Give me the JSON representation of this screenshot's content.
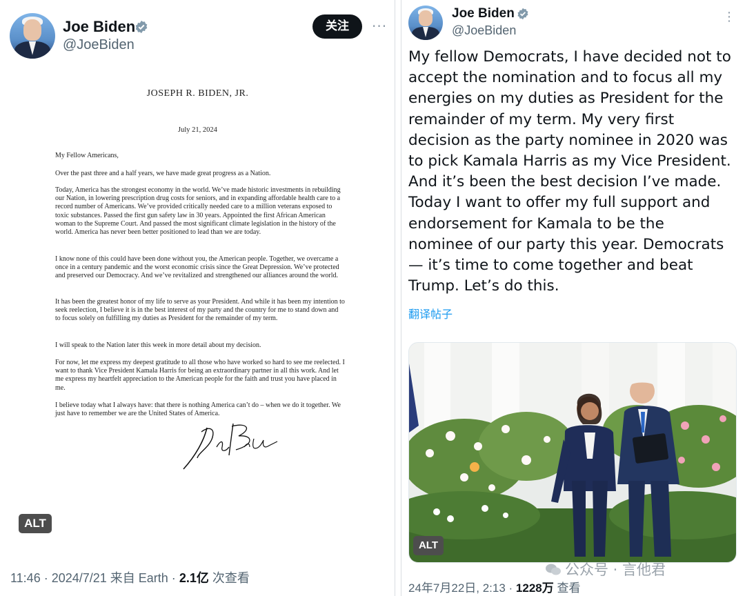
{
  "left_post": {
    "author": {
      "name": "Joe Biden",
      "handle": "@JoeBiden"
    },
    "follow_label": "关注",
    "more_label": "···",
    "letter": {
      "heading": "JOSEPH R. BIDEN, JR.",
      "date": "July 21, 2024",
      "salutation": "My Fellow Americans,",
      "paragraphs": [
        "Over the past three and a half years, we have made great progress as a Nation.",
        "Today, America has the strongest economy in the world. We’ve made historic investments in rebuilding our Nation, in lowering prescription drug costs for seniors, and in expanding affordable health care to a record number of Americans. We’ve provided critically needed care to a million veterans exposed to toxic substances. Passed the first gun safety law in 30 years. Appointed the first African American woman to the Supreme Court. And passed the most significant climate legislation in the history of the world. America has never been better positioned to lead than we are today.",
        "I know none of this could have been done without you, the American people. Together, we overcame a once in a century pandemic and the worst economic crisis since the Great Depression. We’ve protected and preserved our Democracy. And we’ve revitalized and strengthened our alliances around the world.",
        "It has been the greatest honor of my life to serve as your President. And while it has been my intention to seek reelection, I believe it is in the best interest of my party and the country for me to stand down and to focus solely on fulfilling my duties as President for the remainder of my term.",
        "I will speak to the Nation later this week in more detail about my decision.",
        "For now, let me express my deepest gratitude to all those who have worked so hard to see me reelected. I want to thank Vice President Kamala Harris for being an extraordinary partner in all this work. And let me express my heartfelt appreciation to the American people for the faith and trust you have placed in me.",
        "I believe today what I always have: that there is nothing America can’t do – when we do it together. We just have to remember we are the United States of America."
      ],
      "signature": "Joe Biden"
    },
    "alt_label": "ALT",
    "meta": {
      "time": "11:46 · 2024/7/21 来自 Earth · ",
      "views": "2.1亿",
      "views_suffix": " 次查看"
    }
  },
  "right_post": {
    "author": {
      "name": "Joe Biden",
      "handle": "@JoeBiden"
    },
    "more_label": "⋮",
    "text": "My fellow Democrats, I have decided not to accept the nomination and to focus all my energies on my duties as President for the remainder of my term. My very first decision as the party nominee in 2020 was to pick Kamala Harris as my Vice President. And it’s been the best decision I’ve made. Today I want to offer my full support and endorsement for Kamala to be the nominee of our party this year. Democrats — it’s time to come together and beat Trump. Let’s do this.",
    "translate_label": "翻译帖子",
    "alt_label": "ALT",
    "meta": {
      "time": "24年7月22日, 2:13 · ",
      "views": "1228万",
      "views_suffix": " 查看"
    },
    "watermark": "公众号 · 言他君"
  },
  "colors": {
    "verified": "#829aab",
    "link": "#1d9bf0",
    "follow_bg": "#0f1419"
  }
}
